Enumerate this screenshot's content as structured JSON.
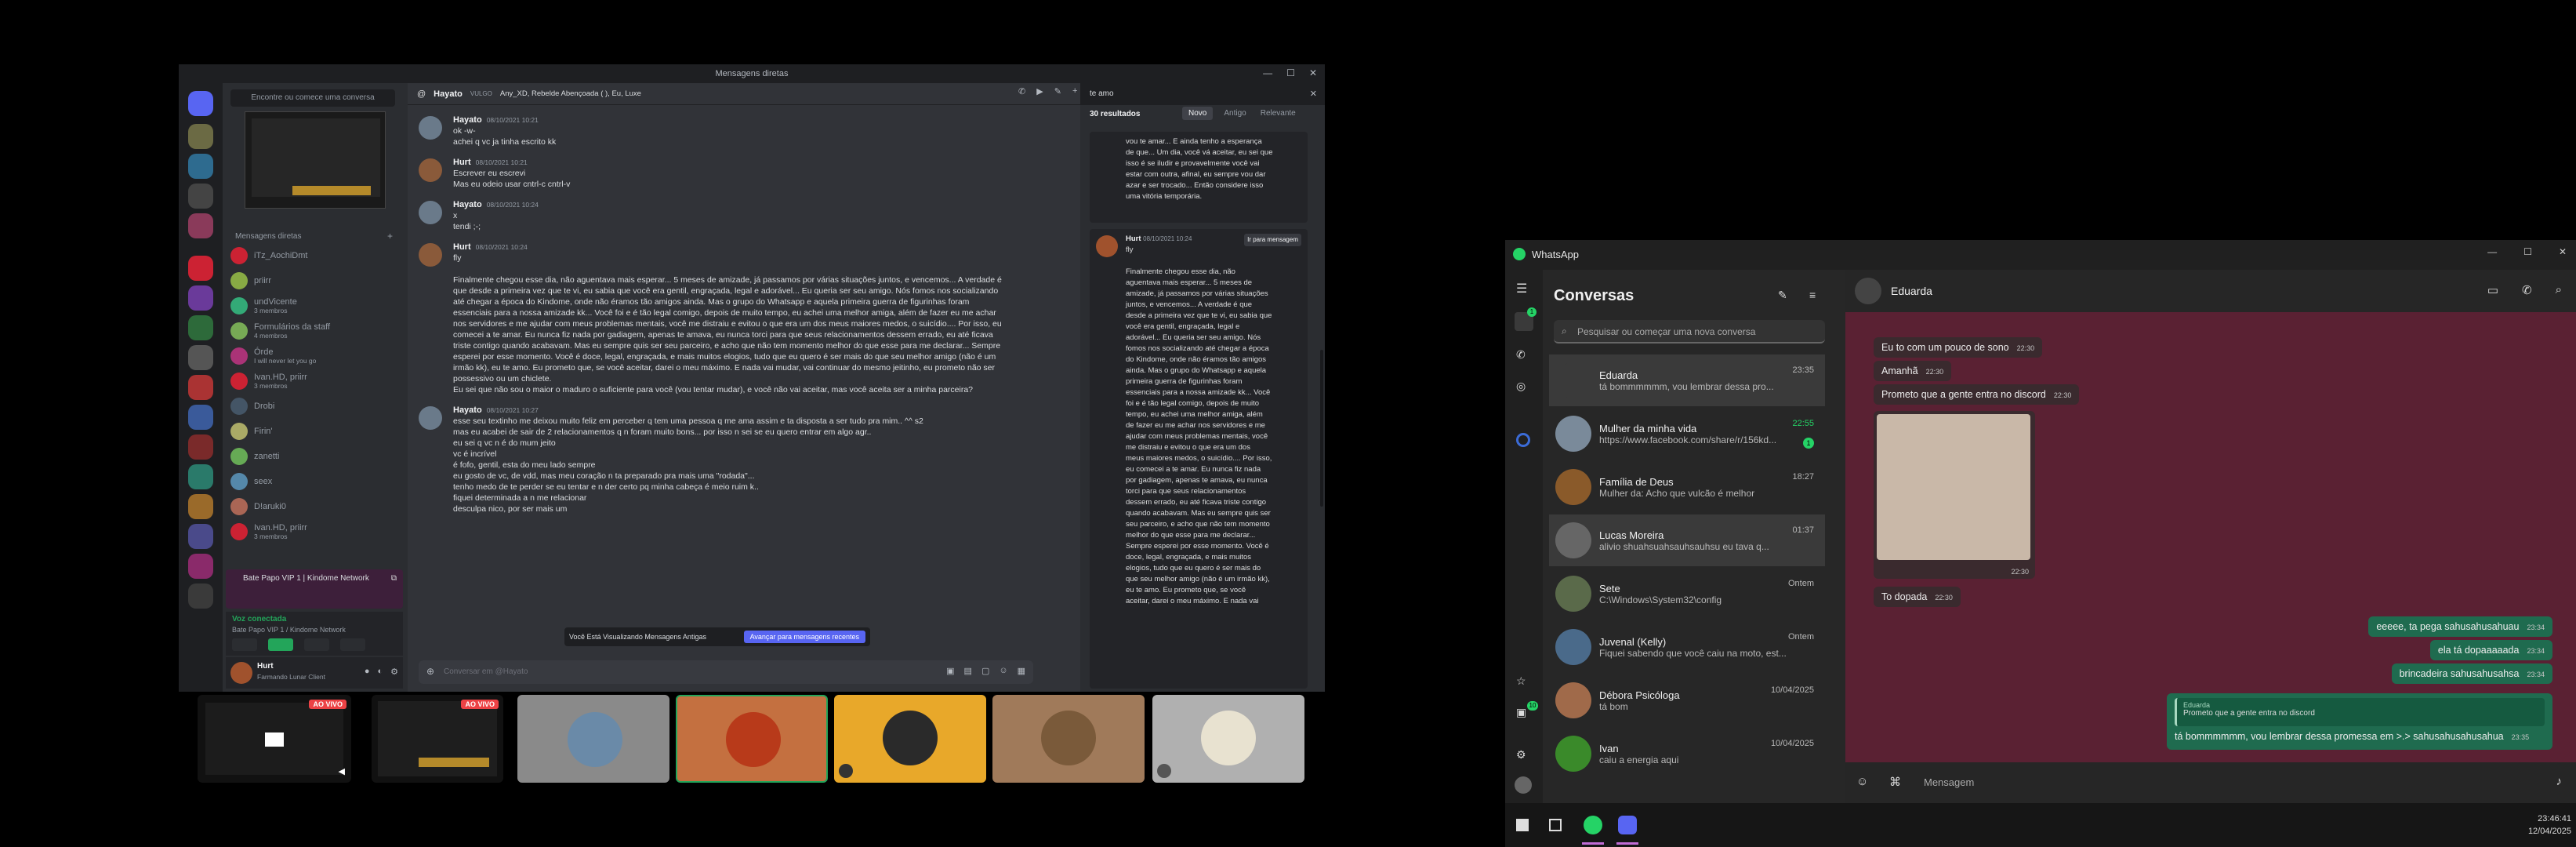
{
  "discord": {
    "title": "Mensagens diretas",
    "find_placeholder": "Encontre ou comece uma conversa",
    "dm_header": "Mensagens diretas",
    "dms": [
      {
        "name": "iTz_AochiDmt"
      },
      {
        "name": "priirr"
      },
      {
        "name": "undVicente",
        "sub": "3 membros"
      },
      {
        "name": "Formulários da staff",
        "sub": "4 membros"
      },
      {
        "name": "Órde",
        "sub": "I will never let you go"
      },
      {
        "name": "Ivan.HD, priirr",
        "sub": "3 membros"
      },
      {
        "name": "Drobi"
      },
      {
        "name": "Firin'"
      },
      {
        "name": "zanetti"
      },
      {
        "name": "seex"
      },
      {
        "name": "D!aruki0"
      },
      {
        "name": "Ivan.HD, priirr",
        "sub": "3 membros"
      }
    ],
    "voice_banner": "Bate Papo VIP 1 | Kindome Network",
    "voice_connected": "Voz conectada",
    "voice_channel": "Bate Papo VIP 1 / Kindome Network",
    "user_name": "Hurt",
    "user_status": "Farmando Lunar Client",
    "chat_header": "Hayato",
    "chat_header_members": "Any_XD, Rebelde Abençoada ( ),  Eu, Luxe",
    "chat_header_tag": "VULGO",
    "search_query": "te amo",
    "results_count": "30 resultados",
    "results_tabs": [
      "Novo",
      "Antigo",
      "Relevante"
    ],
    "messages": [
      {
        "author": "Hayato",
        "time": "08/10/2021 10:21",
        "lines": [
          "ok -w-",
          "achei q vc ja tinha escrito kk"
        ]
      },
      {
        "author": "Hurt",
        "time": "08/10/2021 10:21",
        "lines": [
          "Escrever eu escrevi",
          "Mas eu odeio usar cntrl-c cntrl-v"
        ]
      },
      {
        "author": "Hayato",
        "time": "08/10/2021 10:24",
        "lines": [
          "x",
          "tendi ;-;"
        ]
      },
      {
        "author": "Hurt",
        "time": "08/10/2021 10:24",
        "lines": [
          "fly",
          "",
          "Finalmente chegou esse dia, não aguentava mais esperar... 5 meses de amizade, já passamos por várias situações juntos, e vencemos... A verdade é",
          "que desde a primeira vez que te vi, eu sabia que você era gentil, engraçada, legal e adorável... Eu queria ser seu amigo. Nós fomos nos socializando",
          "até chegar a época do Kindome, onde não éramos tão amigos ainda. Mas o grupo do Whatsapp e aquela primeira guerra de figurinhas foram",
          "essenciais para a nossa amizade kk... Você foi e é tão legal comigo, depois de muito tempo, eu achei uma melhor amiga, além de fazer eu me achar",
          "nos servidores e me ajudar com meus problemas mentais, você me distraiu e evitou o que era um dos meus maiores medos, o suicídio.... Por isso, eu",
          "comecei a te amar. Eu nunca fiz nada por gadiagem, apenas te amava, eu nunca torci para que seus relacionamentos dessem errado, eu até ficava",
          "triste contigo quando acabavam. Mas eu sempre quis ser seu parceiro, e acho que não tem momento melhor do que esse para me declarar... Sempre",
          "esperei por esse momento. Você é doce, legal, engraçada, e mais muitos elogios, tudo que eu quero é ser mais do que seu melhor amigo (não é um",
          "irmão kk), eu te amo. Eu prometo que, se você aceitar, darei o meu máximo. E nada vai mudar, vai continuar do mesmo jeitinho, eu prometo não ser",
          "possessivo ou um chiclete.",
          "Eu sei que não sou o maior o maduro o suficiente para você (vou tentar mudar), e você não vai aceitar, mas você aceita ser a minha parceira?"
        ]
      },
      {
        "author": "Hayato",
        "time": "08/10/2021 10:27",
        "lines": [
          "esse seu textinho me deixou muito feliz em perceber q tem uma pessoa q me ama assim e ta disposta a ser tudo pra mim.. ^^ s2",
          "mas eu acabei de sair de 2 relacionamentos q n foram muito bons... por isso n sei se eu quero entrar em algo agr..",
          "eu sei q vc n é do mum jeito",
          "vc é incrível",
          "é fofo, gentil, esta do meu lado sempre",
          "eu gosto de vc, de vdd, mas meu coração n ta preparado pra mais uma \"rodada\"...",
          "tenho medo de te perder se eu tentar e n der certo pq minha cabeça é meio ruim k..",
          "fiquei determinada a n me relacionar",
          "desculpa nico, por ser mais um"
        ]
      }
    ],
    "composer_placeholder": "Conversar em @Hayato",
    "toast_text": "Você Está Visualizando Mensagens Antigas",
    "toast_button": "Avançar para mensagens recentes",
    "search_results": [
      {
        "lines": [
          "vou te amar... E ainda tenho a esperança",
          "de que... Um dia, você vá aceitar, eu sei que",
          "isso é se iludir e provavelmente você vai",
          "estar com outra, afinal, eu sempre vou dar",
          "azar e ser trocado... Então considere isso",
          "uma vitória temporária."
        ]
      },
      {
        "author": "Hurt",
        "time": "08/10/2021 10:24",
        "jump": "Ir para mensagem",
        "lines": [
          "fly",
          "",
          "Finalmente chegou esse dia, não",
          "aguentava mais esperar... 5 meses de",
          "amizade, já passamos por várias situações",
          "juntos, e vencemos... A verdade é que",
          "desde a primeira vez que te vi, eu sabia que",
          "você era gentil, engraçada, legal e",
          "adorável... Eu queria ser seu amigo. Nós",
          "fomos nos socializando até chegar a época",
          "do Kindome, onde não éramos tão amigos",
          "ainda. Mas o grupo do Whatsapp e aquela",
          "primeira guerra de figurinhas foram",
          "essenciais para a nossa amizade kk... Você",
          "foi e é tão legal comigo, depois de muito",
          "tempo, eu achei uma melhor amiga, além",
          "de fazer eu me achar nos servidores e me",
          "ajudar com meus problemas mentais, você",
          "me distraiu e evitou o que era um dos",
          "meus maiores medos, o suicídio.... Por isso,",
          "eu comecei a te amar. Eu nunca fiz nada",
          "por gadiagem, apenas te amava, eu nunca",
          "torci para que seus relacionamentos",
          "dessem errado, eu até ficava triste contigo",
          "quando acabavam. Mas eu sempre quis ser",
          "seu parceiro, e acho que não tem momento",
          "melhor do que esse para me declarar...",
          "Sempre esperei por esse momento. Você é",
          "doce, legal, engraçada, e mais muitos",
          "elogios, tudo que eu quero é ser mais do",
          "que seu melhor amigo (não é um irmão kk),",
          "eu te amo. Eu prometo que, se você",
          "aceitar, darei o meu máximo. E nada vai"
        ]
      }
    ],
    "live_label": "AO VIVO"
  },
  "whatsapp": {
    "app_title": "WhatsApp",
    "list_title": "Conversas",
    "search_placeholder": "Pesquisar ou começar uma nova conversa",
    "conversations": [
      {
        "name": "Eduarda",
        "time": "23:35",
        "preview": "tá bommmmmm, vou lembrar dessa pro..."
      },
      {
        "name": "Mulher da minha vida",
        "time": "22:55",
        "preview": "https://www.facebook.com/share/r/156kd...",
        "unread": "1"
      },
      {
        "name": "Família de Deus",
        "time": "18:27",
        "preview": "Mulher da: Acho que vulcão é melhor"
      },
      {
        "name": "Lucas Moreira",
        "time": "01:37",
        "preview": "alivio shuahsuahsauhsauhsu eu tava q..."
      },
      {
        "name": "Sete",
        "time": "Ontem",
        "preview": "C:\\Windows\\System32\\config"
      },
      {
        "name": "Juvenal (Kelly)",
        "time": "Ontem",
        "preview": "Fiquei sabendo que você caiu na moto, est..."
      },
      {
        "name": "Débora Psicóloga",
        "time": "10/04/2025",
        "preview": "tá bom"
      },
      {
        "name": "Ivan",
        "time": "10/04/2025",
        "preview": "caiu a energia aqui"
      }
    ],
    "chat_name": "Eduarda",
    "messages_in": [
      {
        "text": "Eu to com um pouco de sono",
        "time": "22:30"
      },
      {
        "text": "Amanhã",
        "time": "22:30"
      },
      {
        "text": "Prometo que a gente entra no discord",
        "time": "22:30"
      },
      {
        "text": "To dopada",
        "time": "22:30"
      }
    ],
    "image_time": "22:30",
    "messages_out": [
      {
        "text": "eeeee, ta pega sahusahusahuau",
        "time": "23:34"
      },
      {
        "text": "ela tá dopaaaaada",
        "time": "23:34"
      },
      {
        "text": "brincadeira sahusahusahsa",
        "time": "23:34"
      }
    ],
    "reply_quote_author": "Eduarda",
    "reply_quote_text": "Prometo que a gente entra no discord",
    "reply_text": "tá bommmmmm, vou lembrar dessa promessa em >.> sahusahusahusahua",
    "reply_time": "23:35",
    "composer_placeholder": "Mensagem",
    "rail_badge": "1",
    "rail_badge2": "10"
  },
  "taskbar": {
    "time": "23:46:41",
    "date": "12/04/2025"
  }
}
